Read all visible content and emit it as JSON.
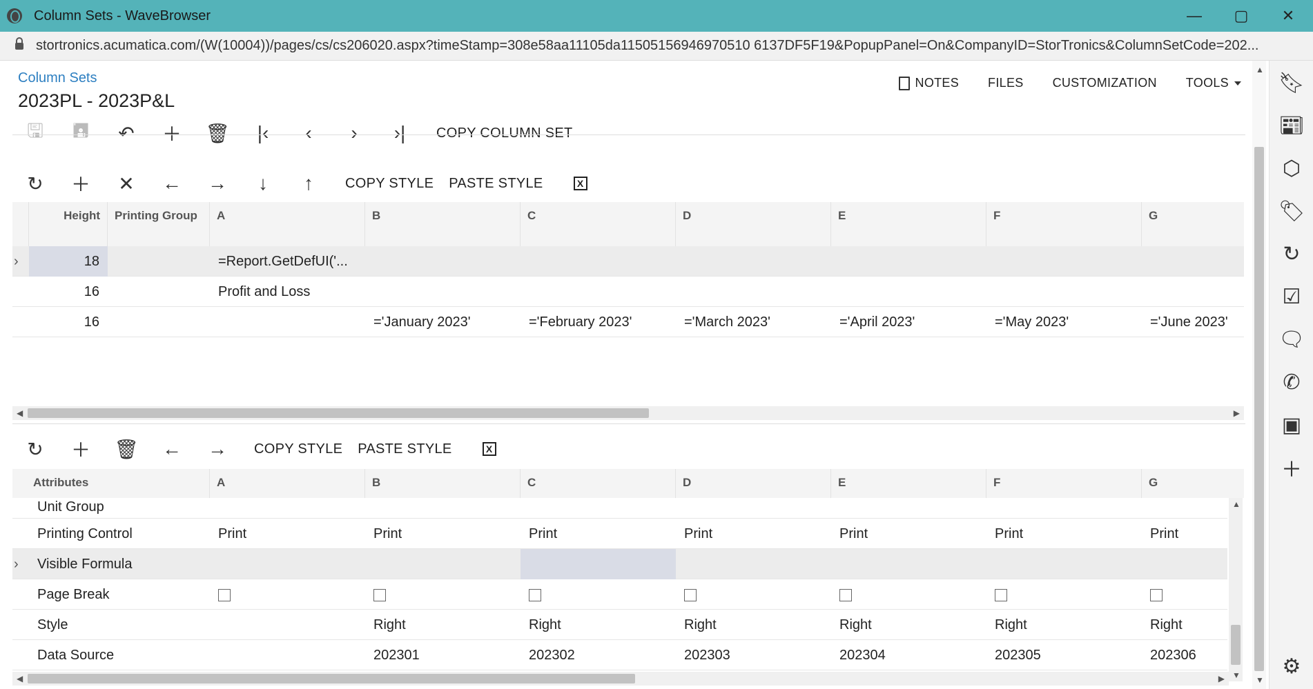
{
  "window": {
    "title": "Column Sets - WaveBrowser"
  },
  "address": {
    "url": "stortronics.acumatica.com/(W(10004))/pages/cs/cs206020.aspx?timeStamp=308e58aa11105da11505156946970510 6137DF5F19&PopupPanel=On&CompanyID=StorTronics&ColumnSetCode=202..."
  },
  "header": {
    "breadcrumb": "Column Sets",
    "title": "2023PL - 2023P&L",
    "links": {
      "notes": "NOTES",
      "files": "FILES",
      "customization": "CUSTOMIZATION",
      "tools": "TOOLS"
    }
  },
  "main_toolbar": {
    "copy_column_set": "COPY COLUMN SET"
  },
  "top_grid": {
    "toolbar": {
      "copy_style": "COPY STYLE",
      "paste_style": "PASTE STYLE",
      "export": "X"
    },
    "headers": {
      "height": "Height",
      "printing_group": "Printing Group",
      "cols": [
        "A",
        "B",
        "C",
        "D",
        "E",
        "F",
        "G"
      ]
    },
    "rows": [
      {
        "height": "18",
        "a": "=Report.GetDefUI('...",
        "b": "",
        "c": "",
        "d": "",
        "e": "",
        "f": "",
        "g": ""
      },
      {
        "height": "16",
        "a": "Profit and Loss",
        "b": "",
        "c": "",
        "d": "",
        "e": "",
        "f": "",
        "g": ""
      },
      {
        "height": "16",
        "a": "",
        "b": "='January 2023'",
        "c": "='February 2023'",
        "d": "='March 2023'",
        "e": "='April 2023'",
        "f": "='May 2023'",
        "g": "='June 2023'"
      }
    ]
  },
  "bottom_grid": {
    "toolbar": {
      "copy_style": "COPY STYLE",
      "paste_style": "PASTE STYLE",
      "export": "X"
    },
    "headers": {
      "attributes": "Attributes",
      "cols": [
        "A",
        "B",
        "C",
        "D",
        "E",
        "F",
        "G"
      ]
    },
    "rows": [
      {
        "label": "Unit Group",
        "vals": [
          "",
          "",
          "",
          "",
          "",
          "",
          ""
        ]
      },
      {
        "label": "Printing Control",
        "vals": [
          "Print",
          "Print",
          "Print",
          "Print",
          "Print",
          "Print",
          "Print"
        ]
      },
      {
        "label": "Visible Formula",
        "vals": [
          "",
          "",
          "",
          "",
          "",
          "",
          ""
        ]
      },
      {
        "label": "Page Break",
        "vals": [
          "",
          "",
          "",
          "",
          "",
          "",
          ""
        ]
      },
      {
        "label": "Style",
        "vals": [
          "",
          "Right",
          "Right",
          "Right",
          "Right",
          "Right",
          "Right"
        ]
      },
      {
        "label": "Data Source",
        "vals": [
          "",
          "202301",
          "202302",
          "202303",
          "202304",
          "202305",
          "202306"
        ]
      }
    ]
  },
  "sidebar": {
    "icons": [
      "bookmark-icon",
      "news-icon",
      "box-icon",
      "tag-icon",
      "sync-icon",
      "checklist-icon",
      "messenger-icon",
      "whatsapp-icon",
      "instagram-icon",
      "plus-icon",
      "gear-icon"
    ]
  }
}
